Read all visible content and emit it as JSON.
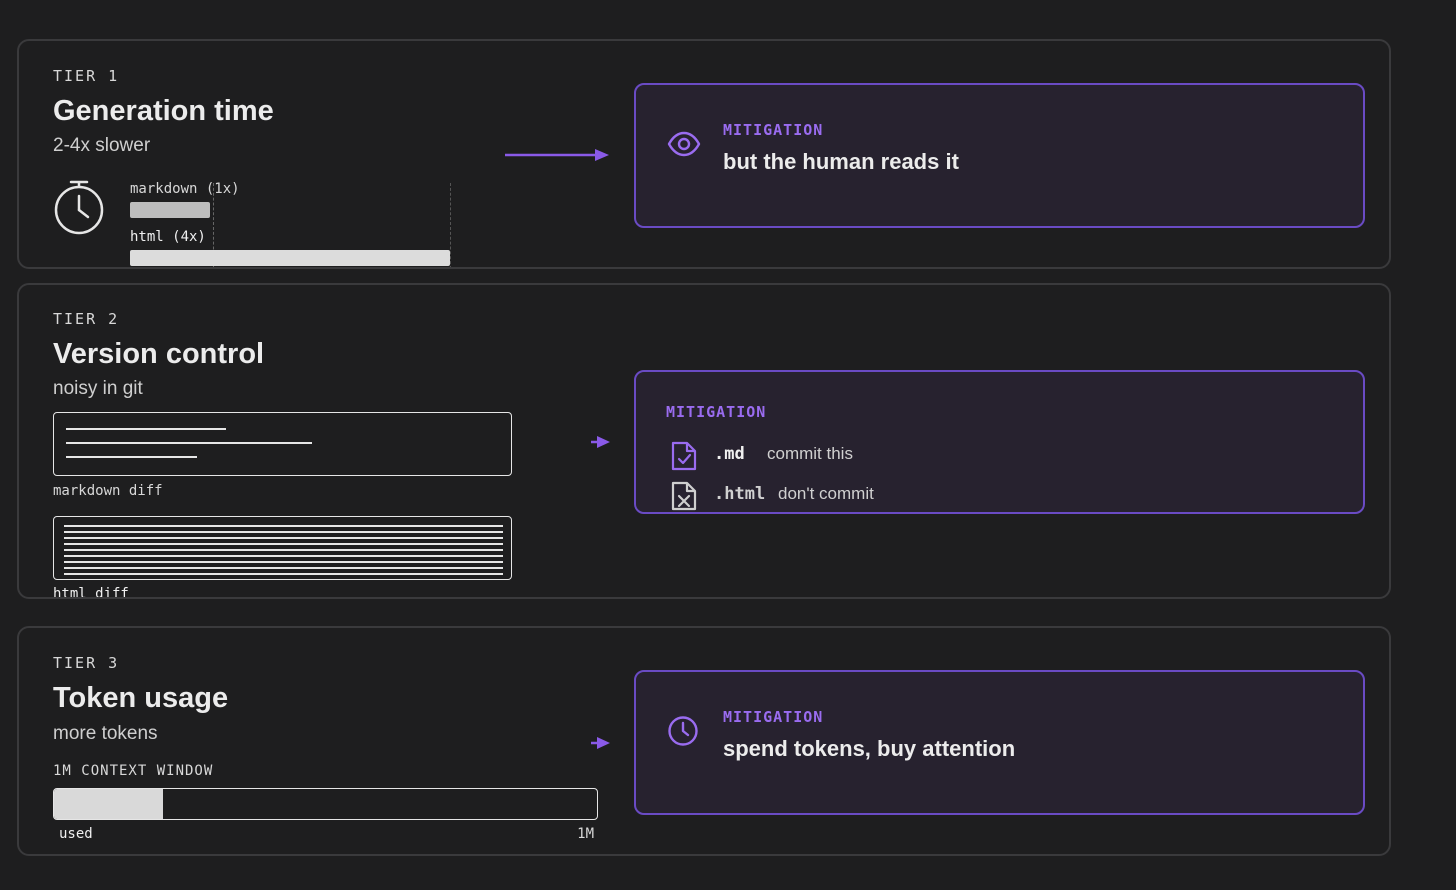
{
  "tiers": [
    {
      "label": "TIER 1",
      "title": "Generation time",
      "subtitle": "2-4x slower",
      "icon": "stopwatch-icon",
      "bars": [
        {
          "label": "markdown (1x)",
          "value": 1
        },
        {
          "label": "html (4x)",
          "value": 4
        }
      ],
      "mitigation": {
        "label": "MITIGATION",
        "icon": "eye-icon",
        "text": "but the human reads it"
      }
    },
    {
      "label": "TIER 2",
      "title": "Version control",
      "subtitle": "noisy in git",
      "diffs": [
        {
          "label": "markdown diff"
        },
        {
          "label": "html diff"
        }
      ],
      "mitigation": {
        "label": "MITIGATION",
        "items": [
          {
            "icon": "file-check-icon",
            "ext": ".md",
            "text": "commit this"
          },
          {
            "icon": "file-x-icon",
            "ext": ".html",
            "text": "don't commit"
          }
        ]
      }
    },
    {
      "label": "TIER 3",
      "title": "Token usage",
      "subtitle": "more tokens",
      "context": {
        "label": "1M CONTEXT WINDOW",
        "used_fraction": 0.2,
        "used_label": "used",
        "max_label": "1M"
      },
      "mitigation": {
        "label": "MITIGATION",
        "icon": "clock-icon",
        "text": "spend tokens, buy attention"
      }
    }
  ],
  "colors": {
    "accent": "#9a6cf0",
    "card_border": "#6a4bc4",
    "card_bg": "#27222f",
    "background": "#1e1e1f"
  }
}
